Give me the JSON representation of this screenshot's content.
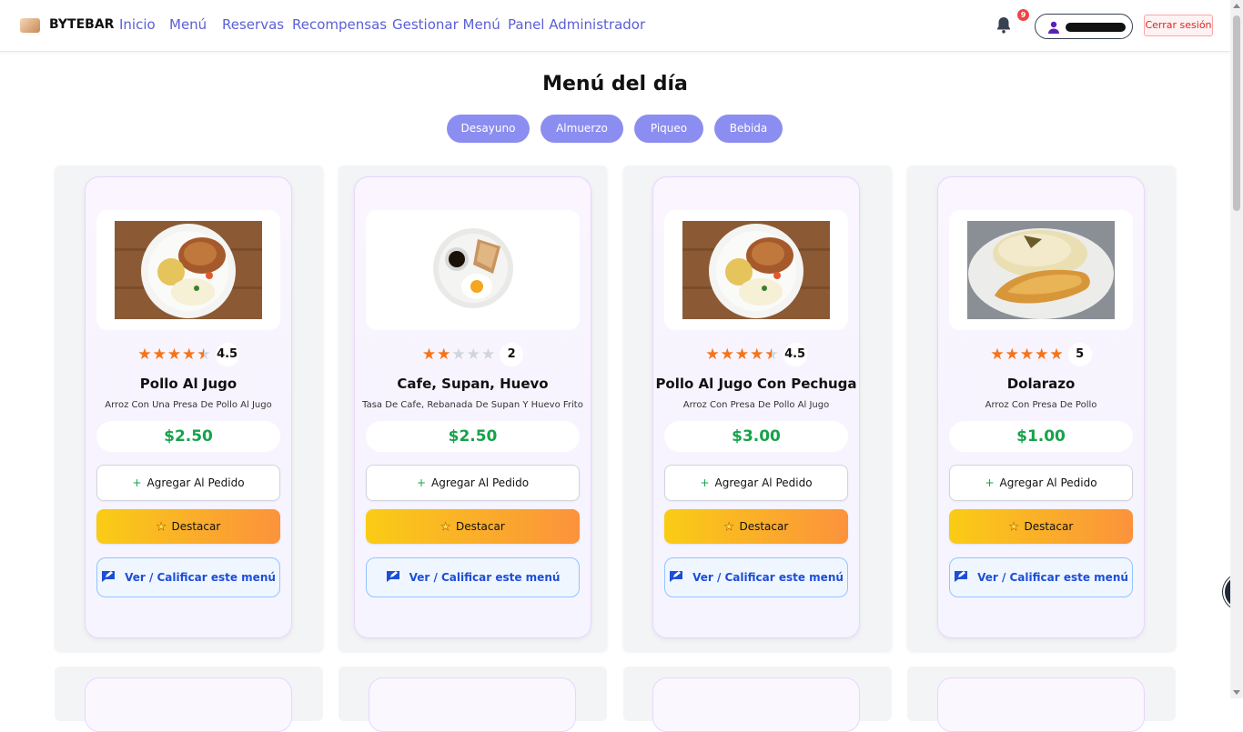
{
  "brand": {
    "name": "BYTEBAR"
  },
  "nav": {
    "links": [
      "Inicio",
      "Menú",
      "Reservas",
      "Recompensas",
      "Gestionar Menú",
      "Panel Administrador"
    ],
    "notifications_count": "9",
    "logout_label": "Cerrar sesión"
  },
  "page": {
    "title": "Menú del día"
  },
  "categories": [
    "Desayuno",
    "Almuerzo",
    "Piqueo",
    "Bebida"
  ],
  "colors": {
    "accent": "#8b8ef0",
    "nav_link": "#5b5fd6",
    "price": "#16a34a",
    "star": "#f97316"
  },
  "cards": [
    {
      "name": "Pollo Al Jugo",
      "description": "Arroz Con Una Presa De Pollo Al Jugo",
      "price": "$2.50",
      "rating": 4.5,
      "rating_label": "4.5",
      "add_label": "Agregar Al Pedido",
      "feature_label": "Destacar",
      "rate_label": "Ver / Calificar este menú"
    },
    {
      "name": "Cafe, Supan, Huevo",
      "description": "Tasa De Cafe, Rebanada De Supan Y Huevo Frito",
      "price": "$2.50",
      "rating": 2,
      "rating_label": "2",
      "add_label": "Agregar Al Pedido",
      "feature_label": "Destacar",
      "rate_label": "Ver / Calificar este menú"
    },
    {
      "name": "Pollo Al Jugo Con Pechuga",
      "description": "Arroz Con Presa De Pollo Al Jugo",
      "price": "$3.00",
      "rating": 4.5,
      "rating_label": "4.5",
      "add_label": "Agregar Al Pedido",
      "feature_label": "Destacar",
      "rate_label": "Ver / Calificar este menú"
    },
    {
      "name": "Dolarazo",
      "description": "Arroz Con Presa De Pollo",
      "price": "$1.00",
      "rating": 5,
      "rating_label": "5",
      "add_label": "Agregar Al Pedido",
      "feature_label": "Destacar",
      "rate_label": "Ver / Calificar este menú"
    }
  ]
}
